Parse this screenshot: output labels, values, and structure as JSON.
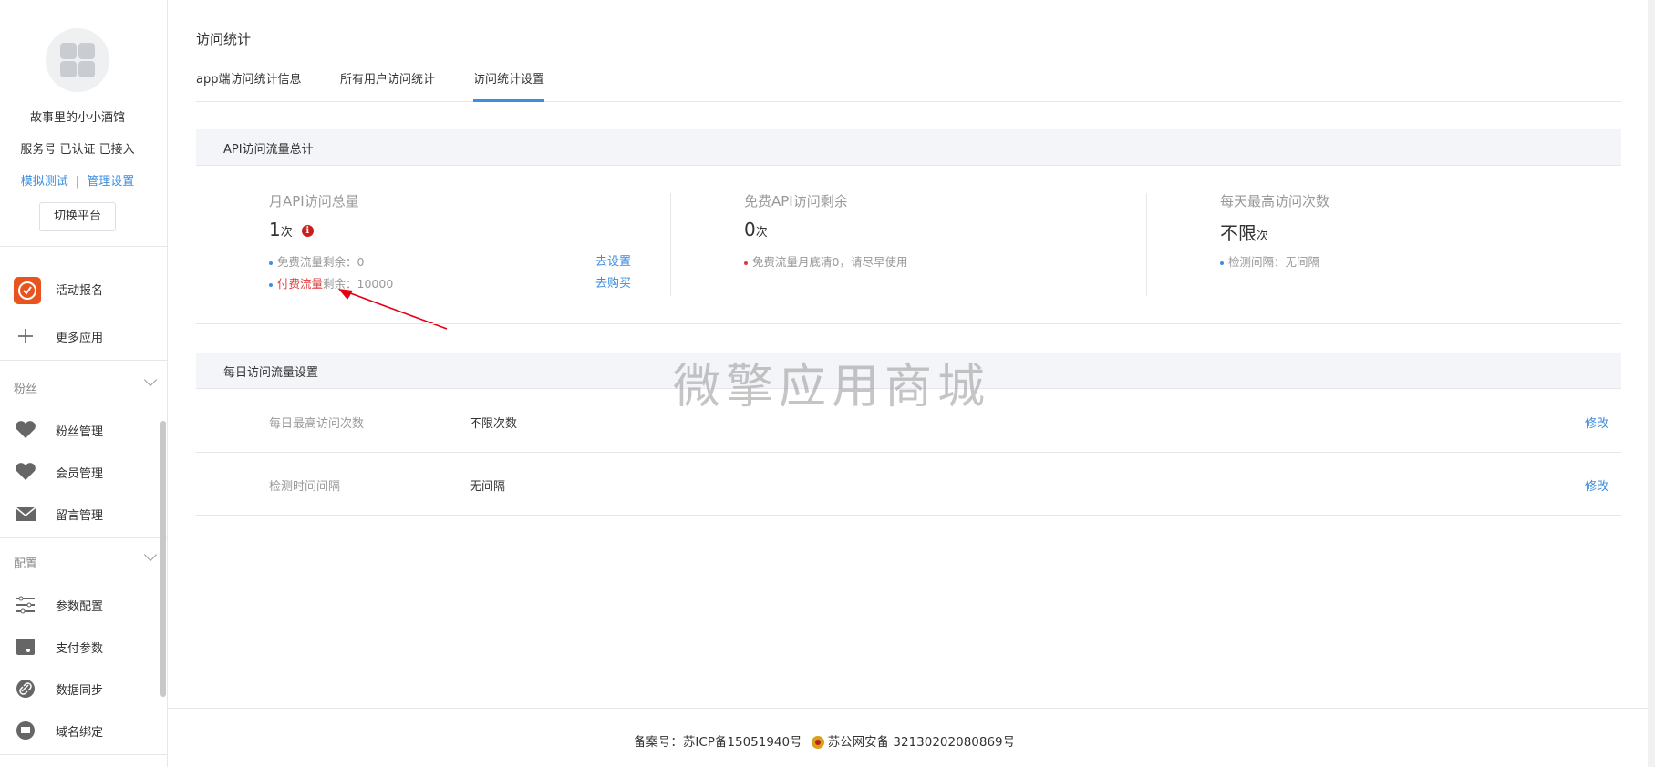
{
  "sidebar": {
    "shop_name": "故事里的小小酒馆",
    "shop_status": "服务号 已认证 已接入",
    "link_simulate": "模拟测试",
    "link_separator": "|",
    "link_manage": "管理设置",
    "switch_platform": "切换平台",
    "apps": [
      {
        "label": "活动报名",
        "icon": "activity-signup-icon"
      },
      {
        "label": "更多应用",
        "icon": "plus-icon"
      }
    ],
    "groups": [
      {
        "title": "粉丝",
        "items": [
          {
            "label": "粉丝管理",
            "icon": "heart-icon"
          },
          {
            "label": "会员管理",
            "icon": "heart-icon"
          },
          {
            "label": "留言管理",
            "icon": "mail-icon"
          }
        ]
      },
      {
        "title": "配置",
        "items": [
          {
            "label": "参数配置",
            "icon": "list-settings-icon"
          },
          {
            "label": "支付参数",
            "icon": "wallet-icon"
          },
          {
            "label": "数据同步",
            "icon": "link-icon"
          },
          {
            "label": "域名绑定",
            "icon": "domain-icon"
          }
        ]
      }
    ]
  },
  "main": {
    "page_title": "访问统计",
    "tabs": [
      {
        "label": "app端访问统计信息",
        "active": false
      },
      {
        "label": "所有用户访问统计",
        "active": false
      },
      {
        "label": "访问统计设置",
        "active": true
      }
    ],
    "api_section": {
      "title": "API访问流量总计",
      "monthly": {
        "label": "月API访问总量",
        "value": "1",
        "unit": "次",
        "free_remaining_label": "免费流量剩余：",
        "free_remaining_value": "0",
        "free_action": "去设置",
        "paid_label": "付费流量",
        "paid_remaining_label": "剩余：",
        "paid_remaining_value": "10000",
        "paid_action": "去购买"
      },
      "free": {
        "label": "免费API访问剩余",
        "value": "0",
        "unit": "次",
        "note": "免费流量月底清0，请尽早使用"
      },
      "daily_max": {
        "label": "每天最高访问次数",
        "value": "不限",
        "unit": "次",
        "note": "检测间隔：无间隔"
      }
    },
    "daily_section": {
      "title": "每日访问流量设置",
      "rows": [
        {
          "key": "每日最高访问次数",
          "value": "不限次数",
          "action": "修改"
        },
        {
          "key": "检测时间间隔",
          "value": "无间隔",
          "action": "修改"
        }
      ]
    },
    "watermark": "微擎应用商城"
  },
  "footer": {
    "icp": "备案号：苏ICP备15051940号",
    "police": "苏公网安备 32130202080869号"
  },
  "colors": {
    "accent": "#3c8ee0",
    "alert": "#e03b3b",
    "section_bg": "#f4f5f9"
  }
}
